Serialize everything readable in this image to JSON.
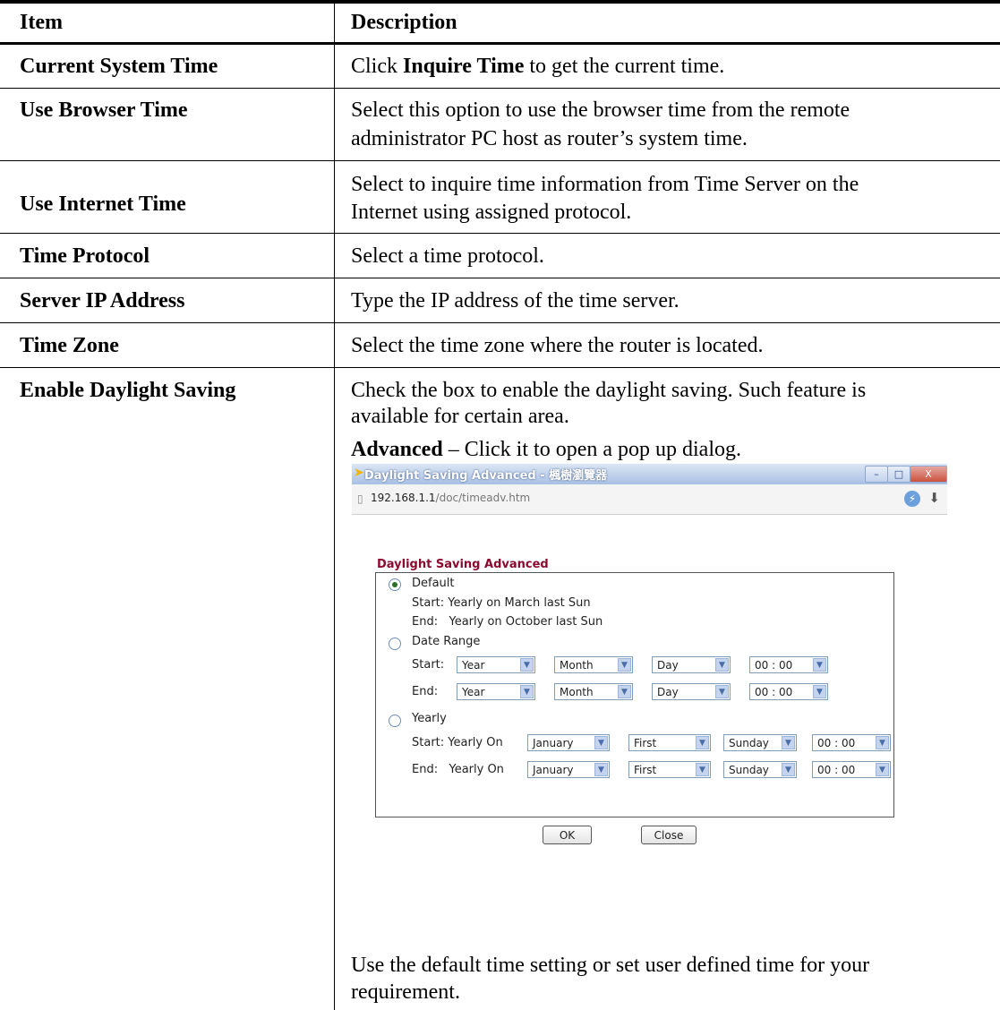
{
  "table": {
    "headers": {
      "item": "Item",
      "description": "Description"
    },
    "rows": [
      {
        "item": "Current System Time",
        "desc_pre": "Click ",
        "desc_bold": "Inquire Time",
        "desc_post": " to get the current time."
      },
      {
        "item": "Use Browser Time",
        "desc_line1": "Select this option to use the browser time from the remote",
        "desc_line2": "administrator PC host as router’s system time."
      },
      {
        "item": "Use Internet Time",
        "desc_line1": "Select to inquire time information from Time Server on the",
        "desc_line2": "Internet using assigned protocol."
      },
      {
        "item": "Time Protocol",
        "desc": "Select a time protocol."
      },
      {
        "item": "Server IP Address",
        "desc": "Type the IP address of the time server."
      },
      {
        "item": "Time Zone",
        "desc": "Select the time zone where the router is located."
      },
      {
        "item": "Enable Daylight Saving",
        "desc_line1": "Check the box to enable the daylight saving. Such feature is",
        "desc_line2": "available for certain area.",
        "adv_bold": "Advanced",
        "adv_rest": " – Click it to open a pop up dialog.",
        "footer_line1": "Use the default time setting or set user defined time for your",
        "footer_line2": "requirement."
      }
    ]
  },
  "popup": {
    "window_title": "Daylight Saving Advanced - 楓樹瀏覽器",
    "url_host": "192.168.1.1",
    "url_path": "/doc/timeadv.htm",
    "window_buttons": {
      "minimize": "–",
      "maximize": "□",
      "close": "X"
    },
    "heading": "Daylight Saving Advanced",
    "default_label": "Default",
    "default_start": "Start: Yearly on March last Sun",
    "default_end": "End:   Yearly on October last Sun",
    "date_range_label": "Date Range",
    "start_label": "Start:",
    "end_label": "End:",
    "year": "Year",
    "month": "Month",
    "day": "Day",
    "time": "00 : 00",
    "yearly_label": "Yearly",
    "yearly_start": "Start: Yearly On",
    "yearly_end": "End:   Yearly On",
    "month_value": "January",
    "week_value": "First",
    "weekday_value": "Sunday",
    "ok": "OK",
    "close": "Close",
    "selected": "Default"
  }
}
